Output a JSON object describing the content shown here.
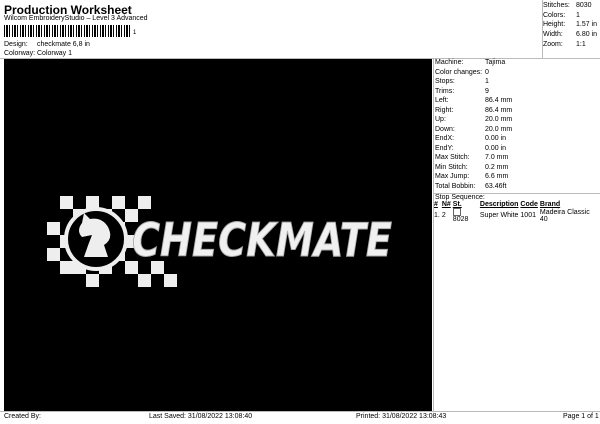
{
  "header": {
    "title": "Production Worksheet",
    "subtitle": "Wilcom EmbroideryStudio – Level 3 Advanced",
    "barcode_number": "1"
  },
  "meta": [
    {
      "label": "Design:",
      "value": "checkmate 6,8 in"
    },
    {
      "label": "Colorway:",
      "value": "Colorway 1"
    }
  ],
  "summary": [
    {
      "label": "Stitches:",
      "value": "8030"
    },
    {
      "label": "Colors:",
      "value": "1"
    },
    {
      "label": "Height:",
      "value": "1.57 in"
    },
    {
      "label": "Width:",
      "value": "6.80 in"
    },
    {
      "label": "Zoom:",
      "value": "1:1"
    }
  ],
  "properties": [
    {
      "label": "Machine:",
      "value": "Tajima"
    },
    {
      "label": "Color changes:",
      "value": "0"
    },
    {
      "label": "Stops:",
      "value": "1"
    },
    {
      "label": "Trims:",
      "value": "9"
    },
    {
      "label": "Left:",
      "value": "86.4 mm"
    },
    {
      "label": "Right:",
      "value": "86.4 mm"
    },
    {
      "label": "Up:",
      "value": "20.0 mm"
    },
    {
      "label": "Down:",
      "value": "20.0 mm"
    },
    {
      "label": "EndX:",
      "value": "0.00 in"
    },
    {
      "label": "EndY:",
      "value": "0.00 in"
    },
    {
      "label": "Max Stitch:",
      "value": "7.0 mm"
    },
    {
      "label": "Min Stitch:",
      "value": "0.2 mm"
    },
    {
      "label": "Max Jump:",
      "value": "6.6 mm"
    },
    {
      "label": "Total Bobbin:",
      "value": "63.46ft"
    }
  ],
  "stop_sequence": {
    "title": "Stop Sequence:",
    "headers": {
      "num": "#",
      "n": "N#",
      "st": "St.",
      "description": "Description",
      "code": "Code",
      "brand": "Brand"
    },
    "rows": [
      {
        "num": "1.",
        "n": "2",
        "st": "8028",
        "description": "Super White",
        "code": "1001",
        "brand": "Madeira Classic 40",
        "color": "#ffffff"
      }
    ]
  },
  "design": {
    "text": "CHECKMATE",
    "stitch_color": "#f0f0f0",
    "background": "#000000"
  },
  "footer": {
    "created_by": "Created By:",
    "last_saved": "Last Saved: 31/08/2022 13:08:40",
    "printed": "Printed: 31/08/2022 13:08:43",
    "page": "Page 1 of 1"
  }
}
